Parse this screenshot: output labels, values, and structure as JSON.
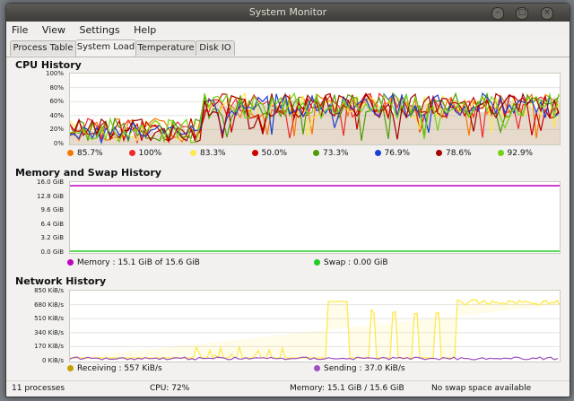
{
  "window": {
    "title": "System Monitor",
    "buttons": [
      "–",
      "□",
      "×"
    ]
  },
  "menu": [
    "File",
    "View",
    "Settings",
    "Help"
  ],
  "tabs": [
    {
      "label": "Process Table",
      "active": false
    },
    {
      "label": "System Load",
      "active": true
    },
    {
      "label": "Temperature",
      "active": false
    },
    {
      "label": "Disk IO",
      "active": false
    }
  ],
  "cpu": {
    "title": "CPU History",
    "yticks": [
      "100%",
      "80%",
      "60%",
      "40%",
      "20%",
      "0%"
    ],
    "legend": [
      {
        "value": "85.7%",
        "color": "#f57900"
      },
      {
        "value": "100%",
        "color": "#ef2929"
      },
      {
        "value": "83.3%",
        "color": "#fce94f"
      },
      {
        "value": "50.0%",
        "color": "#cc0000"
      },
      {
        "value": "73.3%",
        "color": "#4e9a06"
      },
      {
        "value": "76.9%",
        "color": "#1c3fd6"
      },
      {
        "value": "78.6%",
        "color": "#a40000"
      },
      {
        "value": "92.9%",
        "color": "#73d216"
      }
    ]
  },
  "memory": {
    "title": "Memory and Swap History",
    "yticks": [
      "16.0 GiB",
      "12.8 GiB",
      "9.6 GiB",
      "6.4 GiB",
      "3.2 GiB",
      "0.0 GiB"
    ],
    "memory_label": "Memory : 15.1 GiB of 15.6 GiB",
    "swap_label": "Swap : 0.00 GiB",
    "memory_color": "#c000c0",
    "swap_color": "#22cc22"
  },
  "network": {
    "title": "Network History",
    "yticks": [
      "850 KiB/s",
      "680 KiB/s",
      "510 KiB/s",
      "340 KiB/s",
      "170 KiB/s",
      "0 KiB/s"
    ],
    "receiving_label": "Receiving : 557 KiB/s",
    "sending_label": "Sending : 37.0 KiB/s",
    "receiving_color": "#c4a000",
    "sending_color": "#9f4fbf"
  },
  "status": {
    "processes": "11 processes",
    "cpu": "CPU: 72%",
    "memory": "Memory: 15.1 GiB / 15.6 GiB",
    "swap": "No swap space available"
  }
}
